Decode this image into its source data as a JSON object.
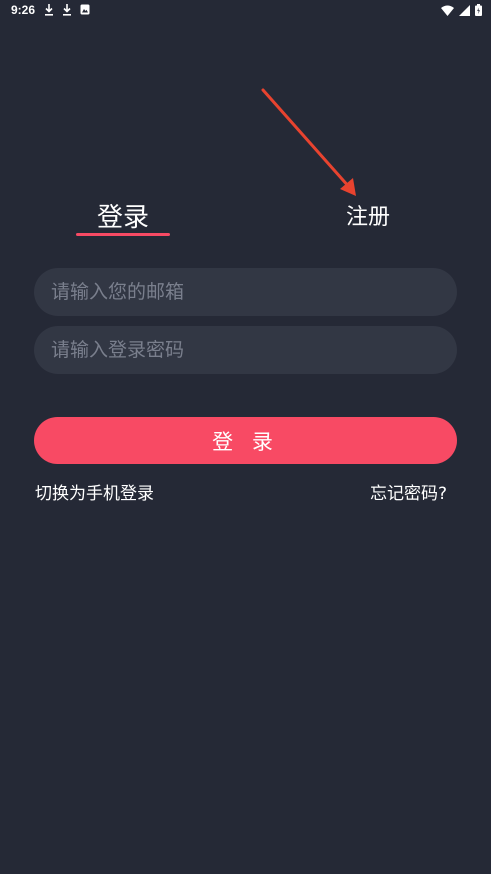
{
  "status_bar": {
    "time": "9:26",
    "icons_left": [
      "download-icon",
      "download-icon",
      "photo-icon"
    ],
    "icons_right": [
      "wifi-icon",
      "signal-icon",
      "battery-icon"
    ]
  },
  "tabs": {
    "login": "登录",
    "register": "注册"
  },
  "form": {
    "email_placeholder": "请输入您的邮箱",
    "email_value": "",
    "password_placeholder": "请输入登录密码",
    "password_value": "",
    "login_button": "登 录"
  },
  "links": {
    "switch_phone": "切换为手机登录",
    "forgot_password": "忘记密码?"
  },
  "colors": {
    "background": "#252936",
    "input_bg": "#323744",
    "accent": "#f84a64",
    "annotation_arrow": "#e8432f"
  }
}
